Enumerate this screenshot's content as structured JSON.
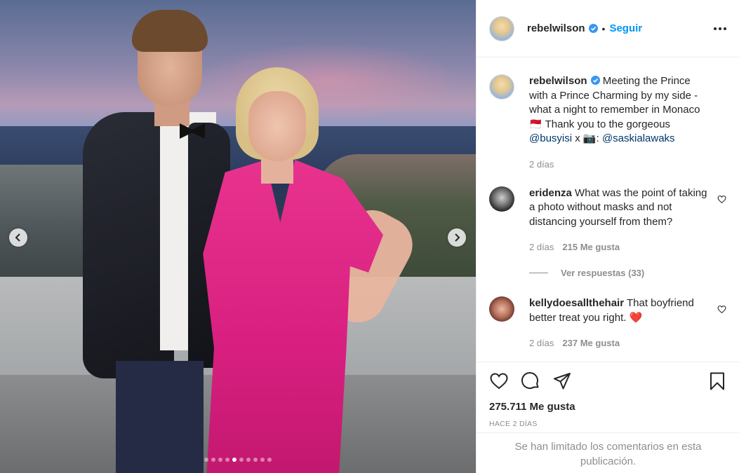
{
  "post": {
    "author": "rebelwilson",
    "separator": "•",
    "follow_label": "Seguir",
    "photo_alt": "Pareja posando en una terraza frente al mar",
    "carousel": {
      "count": 10,
      "active_index": 4
    }
  },
  "caption": {
    "author": "rebelwilson",
    "text_1": "Meeting the Prince with a Prince Charming by my side - what a night to remember in Monaco",
    "flag_emoji": "🇲🇨",
    "text_2": "Thank you to the gorgeous",
    "mention_1": "@busyisi",
    "text_3": "x",
    "camera_emoji": "📷",
    "text_4": ":",
    "mention_2": "@saskialawaks",
    "time": "2 días"
  },
  "comments": [
    {
      "author": "eridenza",
      "text": "What was the point of taking a photo without masks and not distancing yourself from them?",
      "time": "2 días",
      "likes": "215 Me gusta",
      "replies_label": "Ver respuestas (33)"
    },
    {
      "author": "kellydoesallthehair",
      "text": "That boyfriend better treat you right.",
      "emoji": "❤️",
      "time": "2 días",
      "likes": "237 Me gusta"
    }
  ],
  "stats": {
    "likes": "275.711 Me gusta",
    "posted_ago": "HACE 2 DÍAS"
  },
  "limited_notice": "Se han limitado los comentarios en esta publicación.",
  "colors": {
    "accent": "#0095f6",
    "verified": "#3897f0",
    "text": "#262626",
    "muted": "#8e8e8e",
    "mention": "#00376b"
  },
  "icons": [
    "chevron-left-icon",
    "chevron-right-icon",
    "verified-icon",
    "more-icon",
    "heart-icon",
    "comment-icon",
    "share-icon",
    "bookmark-icon"
  ]
}
